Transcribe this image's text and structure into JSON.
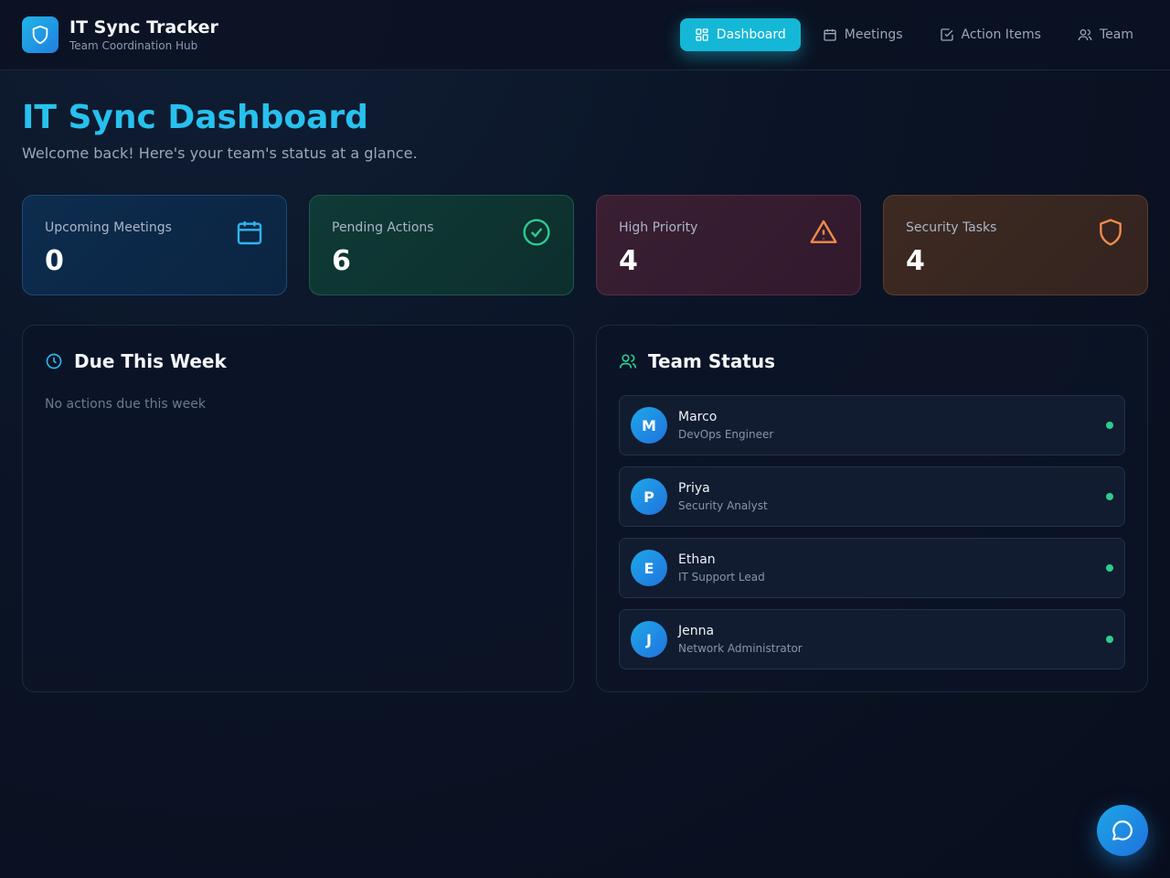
{
  "brand": {
    "title": "IT Sync Tracker",
    "subtitle": "Team Coordination Hub",
    "icon": "shield-icon"
  },
  "nav": [
    {
      "label": "Dashboard",
      "icon": "grid-icon",
      "active": true
    },
    {
      "label": "Meetings",
      "icon": "calendar-icon",
      "active": false
    },
    {
      "label": "Action Items",
      "icon": "checkbox-icon",
      "active": false
    },
    {
      "label": "Team",
      "icon": "users-icon",
      "active": false
    }
  ],
  "page": {
    "title": "IT Sync Dashboard",
    "subtitle": "Welcome back! Here's your team's status at a glance."
  },
  "stats": [
    {
      "label": "Upcoming Meetings",
      "value": "0",
      "icon": "calendar-icon",
      "color": "#2bb7ee"
    },
    {
      "label": "Pending Actions",
      "value": "6",
      "icon": "check-circle-icon",
      "color": "#2ecc8f"
    },
    {
      "label": "High Priority",
      "value": "4",
      "icon": "alert-triangle-icon",
      "color": "#f08a4b"
    },
    {
      "label": "Security Tasks",
      "value": "4",
      "icon": "shield-icon",
      "color": "#f08a4b"
    }
  ],
  "due": {
    "title": "Due This Week",
    "icon": "clock-icon",
    "empty": "No actions due this week"
  },
  "team": {
    "title": "Team Status",
    "icon": "users-icon",
    "members": [
      {
        "initial": "M",
        "name": "Marco",
        "role": "DevOps Engineer",
        "status_color": "#2ecc8f"
      },
      {
        "initial": "P",
        "name": "Priya",
        "role": "Security Analyst",
        "status_color": "#2ecc8f"
      },
      {
        "initial": "E",
        "name": "Ethan",
        "role": "IT Support Lead",
        "status_color": "#2ecc8f"
      },
      {
        "initial": "J",
        "name": "Jenna",
        "role": "Network Administrator",
        "status_color": "#2ecc8f"
      }
    ]
  },
  "chat": {
    "icon": "chat-bubble-icon"
  }
}
